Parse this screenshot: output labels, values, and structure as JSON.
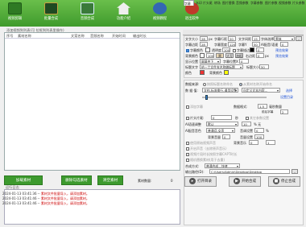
{
  "toolbar": {
    "items": [
      {
        "label": "视频剪辑",
        "color": "#2f7a24"
      },
      {
        "label": "批量合成",
        "color": "#2a5a30"
      },
      {
        "label": "音频合成",
        "color": "#3a7a3a"
      },
      {
        "label": "功能介绍",
        "color": "#4b8f41"
      },
      {
        "label": "视频教程",
        "color": "#3467b3"
      },
      {
        "label": "退出软件",
        "color": "#c0392b"
      }
    ]
  },
  "left": {
    "group_hint": "添加视频到列表(可 拉框到列表里操作)",
    "columns": [
      "序号",
      "素材名称",
      "文案名称",
      "音频名称",
      "开始时间",
      "输出时长"
    ],
    "buttons": {
      "add": "加载素材",
      "del": "删除勾选素材",
      "clear": "清空素材"
    },
    "count_label": "素材数量:",
    "count_value": "0"
  },
  "log": {
    "title": "运行日志",
    "lines": [
      {
        "time": "2024-01-13 03:41:36 -- ",
        "msg": "素材文件批量导入，请添加素材。"
      },
      {
        "time": "2024-01-13 03:41:46 -- ",
        "msg": "素材文件批量导入，请添加素材。"
      },
      {
        "time": "2024-01-13 03:41:46 -- ",
        "msg": "素材文件批量导入，请添加素材。"
      }
    ]
  },
  "tabs": [
    "字幕",
    "水印",
    "片头尾",
    "转场",
    "图片替换",
    "音频参数",
    "字幕参数",
    "图片参数",
    "视频参数",
    "片头参数"
  ],
  "font": {
    "size_label": "文字大小",
    "size": "28",
    "size_unit": "px",
    "line_label": "字幕行距",
    "line": "20",
    "word_label": "文字间距",
    "word": "15",
    "margin_label": "字幕边距",
    "margin": "28",
    "w_label": "字幕宽度",
    "w": "120",
    "font_label": "字体选择",
    "font": "黑体",
    "y_label": "字幕Y",
    "y": "50",
    "ai_label": "AI配音/语速",
    "ai": "0",
    "chk1": "字幕颜色",
    "alpha_label": "透明度",
    "alpha": "100",
    "chk2": "字幕描边",
    "stroke": "0",
    "link1": "预览效果",
    "bg_label": "背景颜色",
    "bg_alpha": "100",
    "tags": [
      "黑",
      "大写",
      "加粗"
    ],
    "right_label": "右边距",
    "right": "0",
    "right_unit": "px",
    "link2": "预览效果",
    "pos_label": "显示位置",
    "pos_val": "屏幕中下",
    "x_label": "字幕位置X",
    "x": "0",
    "text_label": "标题文字",
    "text_val": "给一个文件夹名称做标题",
    "size2_label": "标题大小",
    "size2": "50",
    "color2_label": "颜色",
    "bg2_label": "背景颜色"
  },
  "params": {
    "mode_label": "数据来源:",
    "mode1": "按照标题名称命名",
    "mode2": "从素材名称开始命名",
    "dir_label": "数 据 值:",
    "dir_val": "文档-标准换行-通用设置",
    "dir_val2": "自定义文本内容...",
    "btn1": "选择",
    "btn2": "设置目录",
    "chk_a": "添加字幕",
    "chk_b": "数据格式:",
    "val_b": "1.5",
    "unit_b": "毫秒数量",
    "sec_a": "前后字幕",
    "sec_a_val": "2",
    "chk_c": "片头片尾:",
    "val_c": "0",
    "unit_c": "秒",
    "chk_c2": "其它参数设置",
    "sub_label": "AI语速调整",
    "sub_val": "默认",
    "sub_num": "10",
    "sub_num_unit": "% 无",
    "ai_label": "AI配音音色",
    "ai_val": "普通话-女声",
    "pitch_label": "音调设置",
    "pitch_val": "0",
    "pitch_unit": "%",
    "vol_label": "背景音量",
    "vol": "0",
    "vol2_label": "音量设置",
    "vol2": "100",
    "chk_d": "使用原始视频声音",
    "chk_e": "背景音乐",
    "chk_f": "开启声音（去除原声音乐）",
    "chk_f_val": "1",
    "chk_f_val2": "0",
    "chk_g": "视频片段时长按照字幕CAPT时长",
    "chk_h": "随机替换素材(用于去重)",
    "mix_label": "合成方式:",
    "mix_val": "普通合成 - 快速",
    "out_label": "输出路径(D):",
    "out_val": "C:\\Users\\Admin\\Desktop\\Desktop",
    "btn_dir": "打开目录",
    "btn_start": "开始合成",
    "btn_stop": "停止合成"
  }
}
